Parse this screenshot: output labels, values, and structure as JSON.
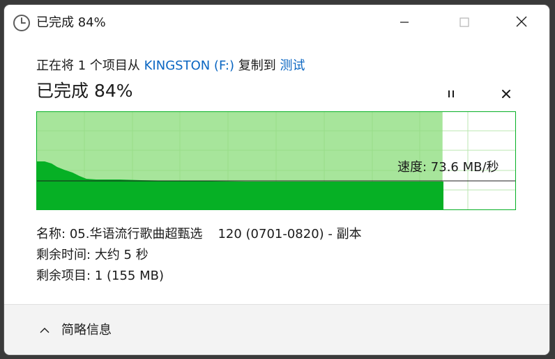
{
  "window": {
    "title": "已完成 84%",
    "minimize_icon": "minimize-icon",
    "maximize_icon": "maximize-icon",
    "close_icon": "close-icon",
    "title_icon": "clock-icon"
  },
  "copy": {
    "prefix": "正在将 1 个项目从 ",
    "source": "KINGSTON (F:)",
    "middle": " 复制到 ",
    "destination": "测试",
    "status": "已完成 84%",
    "progress": 0.84
  },
  "graph": {
    "speed_label": "速度: 73.6 MB/秒",
    "fill_color": "#06b025",
    "light_fill_color": "#a7e59b"
  },
  "details": {
    "name_label": "名称:",
    "name_value": "05.华语流行歌曲超甄选",
    "name_suffix": "120 (0701-0820) - 副本",
    "time_label": "剩余时间:",
    "time_value": "大约 5 秒",
    "items_label": "剩余项目:",
    "items_value": "1 (155 MB)"
  },
  "footer": {
    "toggle_label": "简略信息",
    "toggle_icon": "chevron-up-icon"
  }
}
